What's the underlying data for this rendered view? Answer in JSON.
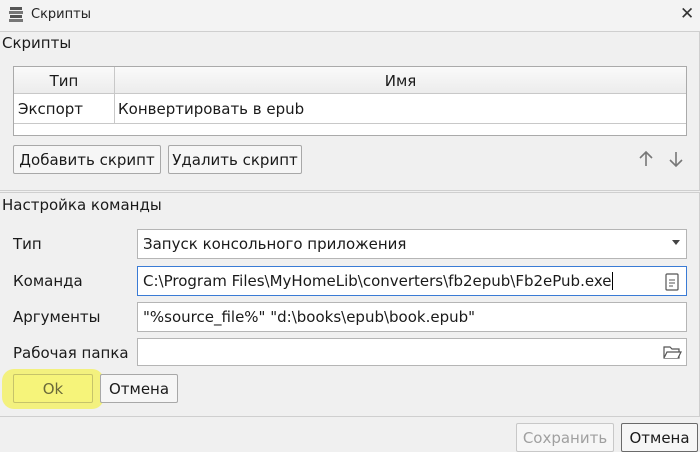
{
  "window": {
    "title": "Скрипты",
    "close_glyph": "✕"
  },
  "scripts_group": {
    "title": "Скрипты",
    "columns": [
      "Тип",
      "Имя"
    ],
    "rows": [
      {
        "type": "Экспорт",
        "name": "Конвертировать в epub"
      }
    ],
    "add_button": "Добавить скрипт",
    "delete_button": "Удалить скрипт",
    "move_up_icon": "arrow-up-icon",
    "move_down_icon": "arrow-down-icon"
  },
  "command_group": {
    "title": "Настройка команды",
    "type_label": "Тип",
    "type_value": "Запуск консольного приложения",
    "command_label": "Команда",
    "command_value": "C:\\Program Files\\MyHomeLib\\converters\\fb2epub\\Fb2ePub.exe",
    "args_label": "Аргументы",
    "args_value": "\"%source_file%\" \"d:\\books\\epub\\book.epub\"",
    "workdir_label": "Рабочая папка",
    "workdir_value": "",
    "ok_button": "Ok",
    "cancel_button": "Отмена"
  },
  "footer": {
    "save_button": "Сохранить",
    "cancel_button": "Отмена"
  },
  "colors": {
    "highlight": "#f3f171",
    "focus_border": "#3a7bd5"
  }
}
